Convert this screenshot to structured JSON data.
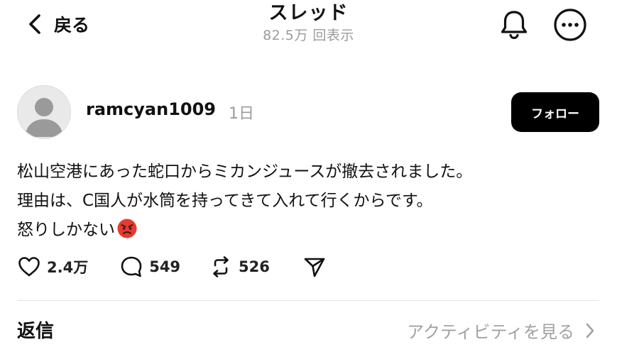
{
  "header": {
    "back_label": "戻る",
    "title": "スレッド",
    "views": "82.5万 回表示"
  },
  "post": {
    "username": "ramcyan1009",
    "time": "1日",
    "follow_label": "フォロー",
    "lines": [
      "松山空港にあった蛇口からミカンジュースが撤去されました。",
      "理由は、C国人が水筒を持ってきて入れて行くからです。",
      "怒りしかない"
    ],
    "emoji": "angry-face-icon",
    "actions": {
      "likes": "2.4万",
      "comments": "549",
      "reposts": "526"
    }
  },
  "footer": {
    "replies_label": "返信",
    "activity_label": "アクティビティを見る"
  },
  "colors": {
    "follow_bg": "#000000",
    "muted_text": "#9b9b9b",
    "divider": "#e4e4e4"
  }
}
